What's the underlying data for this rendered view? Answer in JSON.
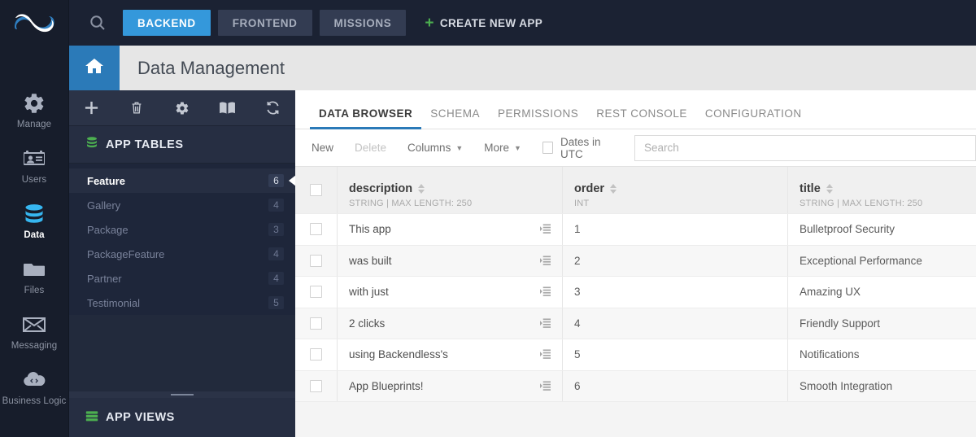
{
  "brand": {
    "logo_name": "backendless-logo"
  },
  "topnav": {
    "search_icon": "search-icon",
    "buttons": [
      {
        "label": "BACKEND",
        "active": true
      },
      {
        "label": "FRONTEND",
        "active": false
      },
      {
        "label": "MISSIONS",
        "active": false
      }
    ],
    "create_app": {
      "plus": "+",
      "label": "CREATE NEW APP"
    }
  },
  "rail": {
    "items": [
      {
        "label": "Manage",
        "icon": "gear-icon",
        "active": false
      },
      {
        "label": "Users",
        "icon": "id-card-icon",
        "active": false
      },
      {
        "label": "Data",
        "icon": "database-icon",
        "active": true
      },
      {
        "label": "Files",
        "icon": "folder-icon",
        "active": false
      },
      {
        "label": "Messaging",
        "icon": "envelope-icon",
        "active": false
      },
      {
        "label": "Business Logic",
        "icon": "cloud-code-icon",
        "active": false
      }
    ]
  },
  "pagehead": {
    "home_icon": "home-icon",
    "title": "Data Management"
  },
  "tables_panel": {
    "toolbar_icons": [
      {
        "name": "add-table-icon"
      },
      {
        "name": "delete-table-icon"
      },
      {
        "name": "table-settings-icon"
      },
      {
        "name": "documentation-icon"
      },
      {
        "name": "refresh-icon"
      }
    ],
    "app_tables_header": {
      "icon": "database-green-icon",
      "label": "APP TABLES"
    },
    "tables": [
      {
        "name": "Feature",
        "count": "6",
        "selected": true
      },
      {
        "name": "Gallery",
        "count": "4",
        "selected": false
      },
      {
        "name": "Package",
        "count": "3",
        "selected": false
      },
      {
        "name": "PackageFeature",
        "count": "4",
        "selected": false
      },
      {
        "name": "Partner",
        "count": "4",
        "selected": false
      },
      {
        "name": "Testimonial",
        "count": "5",
        "selected": false
      }
    ],
    "app_views_header": {
      "icon": "views-green-icon",
      "label": "APP VIEWS"
    }
  },
  "main": {
    "tabs": [
      {
        "label": "DATA BROWSER",
        "active": true
      },
      {
        "label": "SCHEMA",
        "active": false
      },
      {
        "label": "PERMISSIONS",
        "active": false
      },
      {
        "label": "REST CONSOLE",
        "active": false
      },
      {
        "label": "CONFIGURATION",
        "active": false
      }
    ],
    "toolbar": {
      "new_label": "New",
      "delete_label": "Delete",
      "columns_label": "Columns",
      "more_label": "More",
      "dates_utc_label": "Dates in UTC",
      "dates_utc_checked": false,
      "search_placeholder": "Search",
      "search_value": ""
    },
    "grid": {
      "columns": [
        {
          "name": "description",
          "meta": "STRING | MAX LENGTH: 250"
        },
        {
          "name": "order",
          "meta": "INT"
        },
        {
          "name": "title",
          "meta": "STRING | MAX LENGTH: 250"
        }
      ],
      "rows": [
        {
          "description": "This app",
          "order": "1",
          "title": "Bulletproof Security"
        },
        {
          "description": "was built",
          "order": "2",
          "title": "Exceptional Performance"
        },
        {
          "description": "with just",
          "order": "3",
          "title": "Amazing UX"
        },
        {
          "description": "2 clicks",
          "order": "4",
          "title": "Friendly Support"
        },
        {
          "description": "using Backendless's",
          "order": "5",
          "title": "Notifications"
        },
        {
          "description": "App Blueprints!",
          "order": "6",
          "title": "Smooth Integration"
        }
      ]
    }
  },
  "colors": {
    "accent_blue": "#3498db",
    "header_blue": "#2b7ab8",
    "dark_nav": "#1b2233",
    "panel_dark": "#222a3c",
    "green": "#4caf50"
  }
}
